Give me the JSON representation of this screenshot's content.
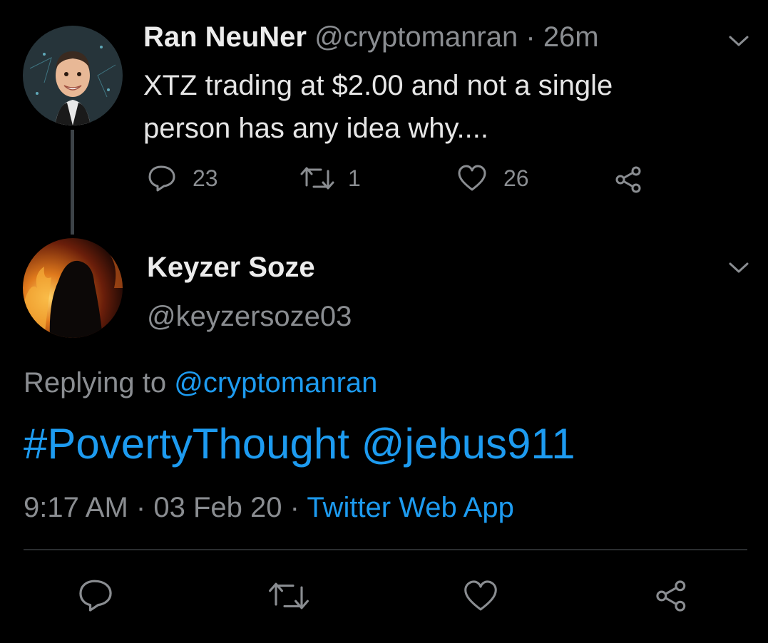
{
  "parent_tweet": {
    "display_name": "Ran NeuNer",
    "handle": "@cryptomanran",
    "separator": "·",
    "time": "26m",
    "text_line1": "XTZ trading at $2.00 and not a single",
    "text_line2": "person has any idea why....",
    "replies": "23",
    "retweets": "1",
    "likes": "26"
  },
  "reply_tweet": {
    "display_name": "Keyzer Soze",
    "handle": "@keyzersoze03",
    "replying_to_label": "Replying to",
    "replying_to_handle": "@cryptomanran",
    "hashtag": "#PovertyThought",
    "mention": "@jebus911",
    "timestamp_time": "9:17 AM",
    "sep1": "·",
    "timestamp_date": "03 Feb 20",
    "sep2": "·",
    "source": "Twitter Web App"
  },
  "colors": {
    "background": "#000000",
    "link_blue": "#1d9bf0",
    "muted_gray": "#8a8d91",
    "text": "#d9d9d9"
  },
  "icons": [
    "chevron-down-icon",
    "reply-icon",
    "retweet-icon",
    "like-icon",
    "share-icon"
  ]
}
